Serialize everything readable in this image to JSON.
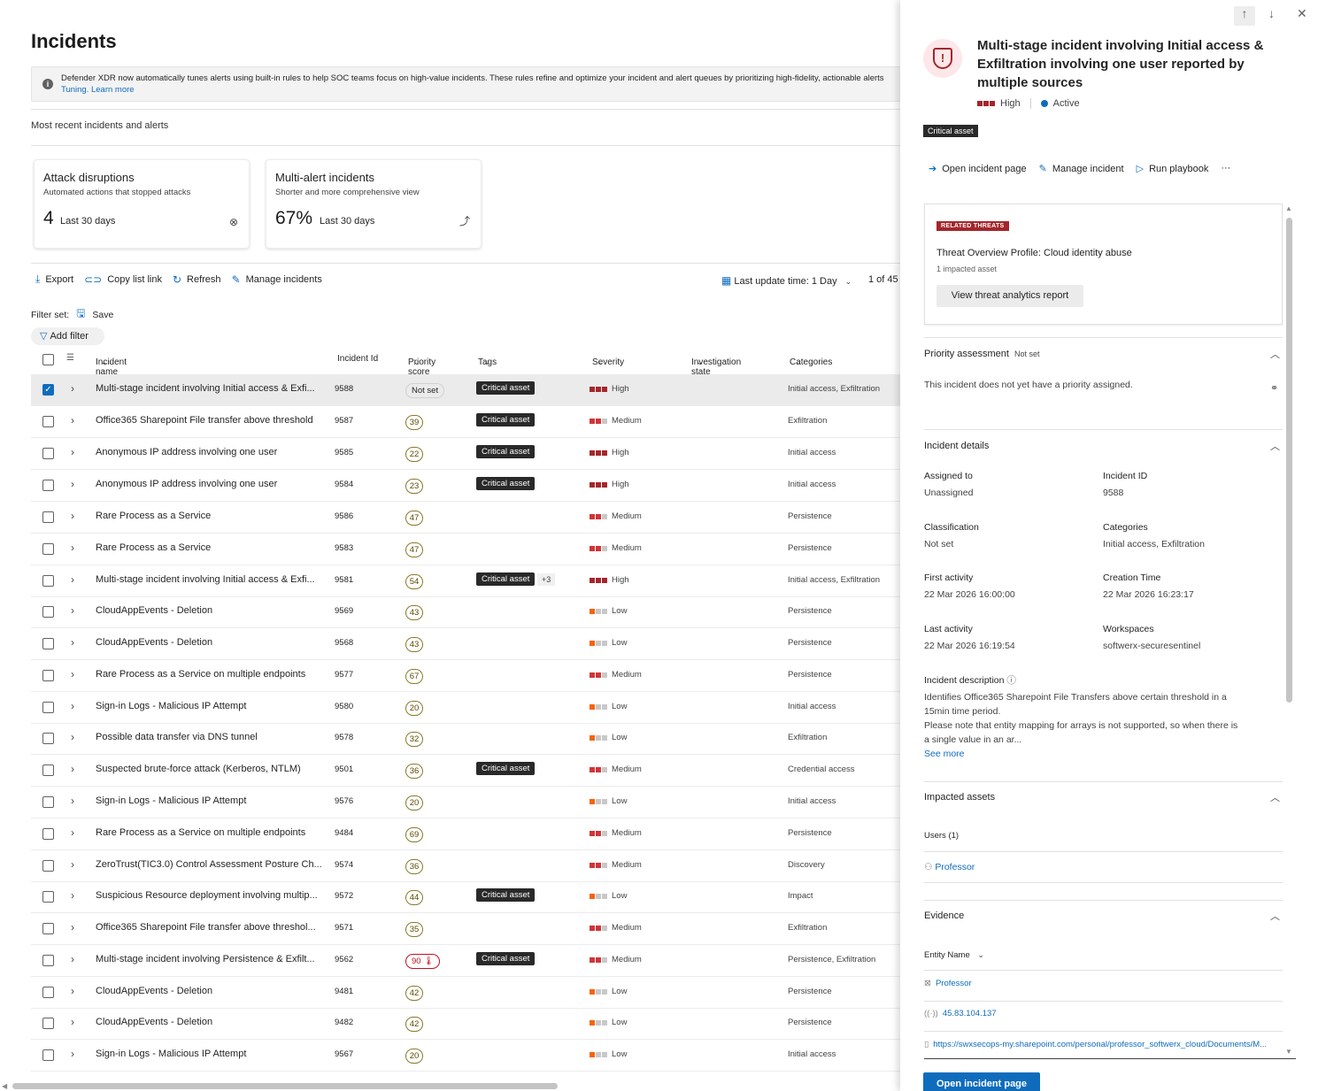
{
  "page": {
    "title": "Incidents"
  },
  "banner": {
    "text": "Defender XDR now automatically tunes alerts using built-in rules to help SOC teams focus on high-value incidents. These rules refine and optimize your incident and alert queues by prioritizing high-fidelity, actionable alerts",
    "link1": "Tuning.",
    "link2": "Learn more"
  },
  "section": {
    "label": "Most recent incidents and alerts"
  },
  "cards": [
    {
      "title": "Attack disruptions",
      "subtitle": "Automated actions that stopped attacks",
      "value": "4",
      "period": "Last 30 days",
      "icon": "shield-check-icon"
    },
    {
      "title": "Multi-alert incidents",
      "subtitle": "Shorter and more comprehensive view",
      "value": "67%",
      "period": "Last 30 days",
      "icon": "merge-icon"
    }
  ],
  "toolbar": {
    "export": "Export",
    "copy_link": "Copy list link",
    "refresh": "Refresh",
    "manage": "Manage incidents",
    "last_update": "Last update time: 1 Day",
    "paging": "1 of 45"
  },
  "filters": {
    "filter_set": "Filter set:",
    "save": "Save",
    "add_filter": "Add filter"
  },
  "columns": {
    "name": "Incident name",
    "id": "Incident Id",
    "priority": "Priority score",
    "tags": "Tags",
    "severity": "Severity",
    "investigation": "Investigation state",
    "categories": "Categories"
  },
  "incidents": [
    {
      "name": "Multi-stage incident involving Initial access & Exfi...",
      "id": "9588",
      "priority": "Not set",
      "tag": "Critical asset",
      "more": "",
      "severity": "High",
      "sev": "high",
      "category": "Initial access, Exfiltration",
      "selected": true
    },
    {
      "name": "Office365 Sharepoint File transfer above threshold",
      "id": "9587",
      "priority": "39",
      "tag": "Critical asset",
      "more": "",
      "severity": "Medium",
      "sev": "medium",
      "category": "Exfiltration"
    },
    {
      "name": "Anonymous IP address involving one user",
      "id": "9585",
      "priority": "22",
      "tag": "Critical asset",
      "more": "",
      "severity": "High",
      "sev": "high",
      "category": "Initial access"
    },
    {
      "name": "Anonymous IP address involving one user",
      "id": "9584",
      "priority": "23",
      "tag": "Critical asset",
      "more": "",
      "severity": "High",
      "sev": "high",
      "category": "Initial access"
    },
    {
      "name": "Rare Process as a Service",
      "id": "9586",
      "priority": "47",
      "tag": "",
      "more": "",
      "severity": "Medium",
      "sev": "medium",
      "category": "Persistence"
    },
    {
      "name": "Rare Process as a Service",
      "id": "9583",
      "priority": "47",
      "tag": "",
      "more": "",
      "severity": "Medium",
      "sev": "medium",
      "category": "Persistence"
    },
    {
      "name": "Multi-stage incident involving Initial access & Exfi...",
      "id": "9581",
      "priority": "54",
      "tag": "Critical asset",
      "more": "+3",
      "severity": "High",
      "sev": "high",
      "category": "Initial access, Exfiltration"
    },
    {
      "name": "CloudAppEvents - Deletion",
      "id": "9569",
      "priority": "43",
      "tag": "",
      "more": "",
      "severity": "Low",
      "sev": "low",
      "category": "Persistence"
    },
    {
      "name": "CloudAppEvents - Deletion",
      "id": "9568",
      "priority": "43",
      "tag": "",
      "more": "",
      "severity": "Low",
      "sev": "low",
      "category": "Persistence"
    },
    {
      "name": "Rare Process as a Service on multiple endpoints",
      "id": "9577",
      "priority": "67",
      "tag": "",
      "more": "",
      "severity": "Medium",
      "sev": "medium",
      "category": "Persistence"
    },
    {
      "name": "Sign-in Logs - Malicious IP Attempt",
      "id": "9580",
      "priority": "20",
      "tag": "",
      "more": "",
      "severity": "Low",
      "sev": "low",
      "category": "Initial access"
    },
    {
      "name": "Possible data transfer via DNS tunnel",
      "id": "9578",
      "priority": "32",
      "tag": "",
      "more": "",
      "severity": "Low",
      "sev": "low",
      "category": "Exfiltration"
    },
    {
      "name": "Suspected brute-force attack (Kerberos, NTLM)",
      "id": "9501",
      "priority": "36",
      "tag": "Critical asset",
      "more": "",
      "severity": "Medium",
      "sev": "medium",
      "category": "Credential access"
    },
    {
      "name": "Sign-in Logs - Malicious IP Attempt",
      "id": "9576",
      "priority": "20",
      "tag": "",
      "more": "",
      "severity": "Low",
      "sev": "low",
      "category": "Initial access"
    },
    {
      "name": "Rare Process as a Service on multiple endpoints",
      "id": "9484",
      "priority": "69",
      "tag": "",
      "more": "",
      "severity": "Medium",
      "sev": "medium",
      "category": "Persistence"
    },
    {
      "name": "ZeroTrust(TIC3.0) Control Assessment Posture Ch...",
      "id": "9574",
      "priority": "36",
      "tag": "",
      "more": "",
      "severity": "Medium",
      "sev": "medium",
      "category": "Discovery"
    },
    {
      "name": "Suspicious Resource deployment involving multip...",
      "id": "9572",
      "priority": "44",
      "tag": "Critical asset",
      "more": "",
      "severity": "Low",
      "sev": "low",
      "category": "Impact"
    },
    {
      "name": "Office365 Sharepoint File transfer above threshol...",
      "id": "9571",
      "priority": "35",
      "tag": "",
      "more": "",
      "severity": "Medium",
      "sev": "medium",
      "category": "Exfiltration"
    },
    {
      "name": "Multi-stage incident involving Persistence & Exfilt...",
      "id": "9562",
      "priority": "90",
      "tag": "Critical asset",
      "more": "",
      "severity": "Medium",
      "sev": "medium",
      "category": "Persistence, Exfiltration",
      "hot": true
    },
    {
      "name": "CloudAppEvents - Deletion",
      "id": "9481",
      "priority": "42",
      "tag": "",
      "more": "",
      "severity": "Low",
      "sev": "low",
      "category": "Persistence"
    },
    {
      "name": "CloudAppEvents - Deletion",
      "id": "9482",
      "priority": "42",
      "tag": "",
      "more": "",
      "severity": "Low",
      "sev": "low",
      "category": "Persistence"
    },
    {
      "name": "Sign-in Logs - Malicious IP Attempt",
      "id": "9567",
      "priority": "20",
      "tag": "",
      "more": "",
      "severity": "Low",
      "sev": "low",
      "category": "Initial access"
    }
  ],
  "panel": {
    "title": "Multi-stage incident involving Initial access & Exfiltration involving one user reported by multiple sources",
    "severity": "High",
    "status": "Active",
    "badge": "Critical asset",
    "actions": {
      "open": "Open incident page",
      "manage": "Manage incident",
      "playbook": "Run playbook",
      "more": "···"
    },
    "threat": {
      "badge": "RELATED THREATS",
      "title": "Threat Overview Profile: Cloud identity abuse",
      "sub": "1 impacted asset",
      "button": "View threat analytics report"
    },
    "priority": {
      "heading": "Priority assessment",
      "value": "Not set",
      "text": "This incident does not yet have a priority assigned."
    },
    "details": {
      "heading": "Incident details",
      "assigned_k": "Assigned to",
      "assigned_v": "Unassigned",
      "id_k": "Incident ID",
      "id_v": "9588",
      "class_k": "Classification",
      "class_v": "Not set",
      "cat_k": "Categories",
      "cat_v": "Initial access, Exfiltration",
      "first_k": "First activity",
      "first_v": "22 Mar 2026 16:00:00",
      "created_k": "Creation Time",
      "created_v": "22 Mar 2026 16:23:17",
      "last_k": "Last activity",
      "last_v": "22 Mar 2026 16:19:54",
      "ws_k": "Workspaces",
      "ws_v": "softwerx-securesentinel"
    },
    "description": {
      "heading": "Incident description",
      "line1": "Identifies Office365 Sharepoint File Transfers above certain threshold in a",
      "line2": "15min time period.",
      "line3": "Please note that entity mapping for arrays is not supported, so when there is",
      "line4": "a single value in an ar...",
      "see_more": "See more"
    },
    "assets": {
      "heading": "Impacted assets",
      "users": "Users (1)",
      "user": "Professor"
    },
    "evidence": {
      "heading": "Evidence",
      "column": "Entity Name",
      "items": [
        {
          "icon": "user-entity-icon",
          "text": "Professor"
        },
        {
          "icon": "ip-icon",
          "text": "45.83.104.137"
        },
        {
          "icon": "file-icon",
          "text": "https://swxsecops-my.sharepoint.com/personal/professor_softwerx_cloud/Documents/M..."
        }
      ]
    },
    "primary_button": "Open incident page"
  }
}
